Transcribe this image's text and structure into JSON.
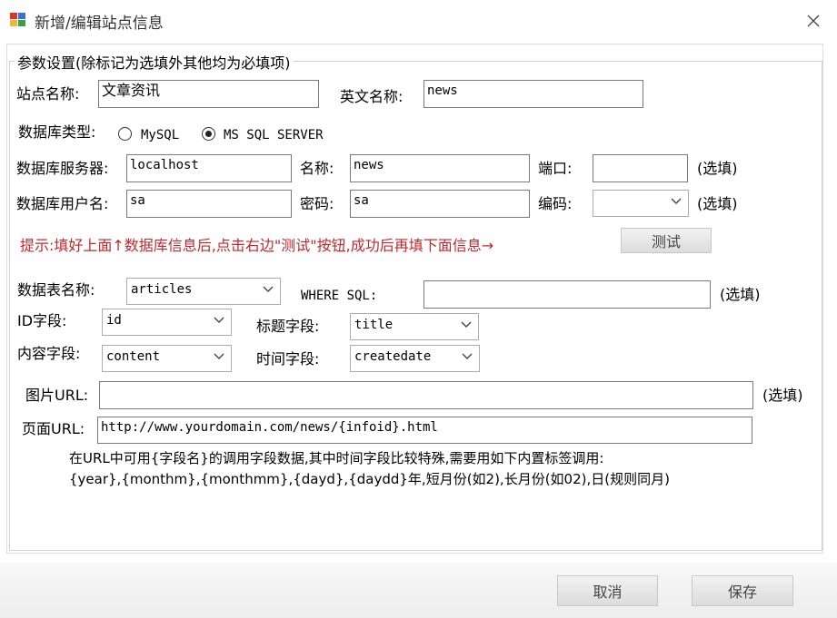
{
  "window": {
    "title": "新增/编辑站点信息"
  },
  "group": {
    "legend": "参数设置(除标记为选填外其他均为必填项)"
  },
  "site": {
    "name_label": "站点名称:",
    "name_value": "文章资讯",
    "en_label": "英文名称:",
    "en_value": "news"
  },
  "db": {
    "type_label": "数据库类型:",
    "type_options": [
      {
        "label": "MySQL",
        "checked": false
      },
      {
        "label": "MS SQL SERVER",
        "checked": true
      }
    ],
    "server_label": "数据库服务器:",
    "server_value": "localhost",
    "name_label": "名称:",
    "name_value": "news",
    "port_label": "端口:",
    "port_value": "",
    "optional": "(选填)",
    "user_label": "数据库用户名:",
    "user_value": "sa",
    "password_label": "密码:",
    "password_value": "sa",
    "encoding_label": "编码:",
    "encoding_value": "",
    "hint": "提示:填好上面↑数据库信息后,点击右边\"测试\"按钮,成功后再填下面信息→",
    "test_button": "测试"
  },
  "table": {
    "name_label": "数据表名称:",
    "name_value": "articles",
    "where_label": "WHERE SQL:",
    "where_value": "",
    "id_label": "ID字段:",
    "id_value": "id",
    "title_label": "标题字段:",
    "title_value": "title",
    "content_label": "内容字段:",
    "content_value": "content",
    "time_label": "时间字段:",
    "time_value": "createdate",
    "image_label": "图片URL:",
    "image_value": "",
    "page_label": "页面URL:",
    "page_value": "http://www.yourdomain.com/news/{infoid}.html",
    "note_line1": "在URL中可用{字段名}的调用字段数据,其中时间字段比较特殊,需要用如下内置标签调用:",
    "note_line2": "{year},{monthm},{monthmm},{dayd},{daydd}年,短月份(如2),长月份(如02),日(规则同月)"
  },
  "footer": {
    "cancel": "取消",
    "save": "保存"
  }
}
